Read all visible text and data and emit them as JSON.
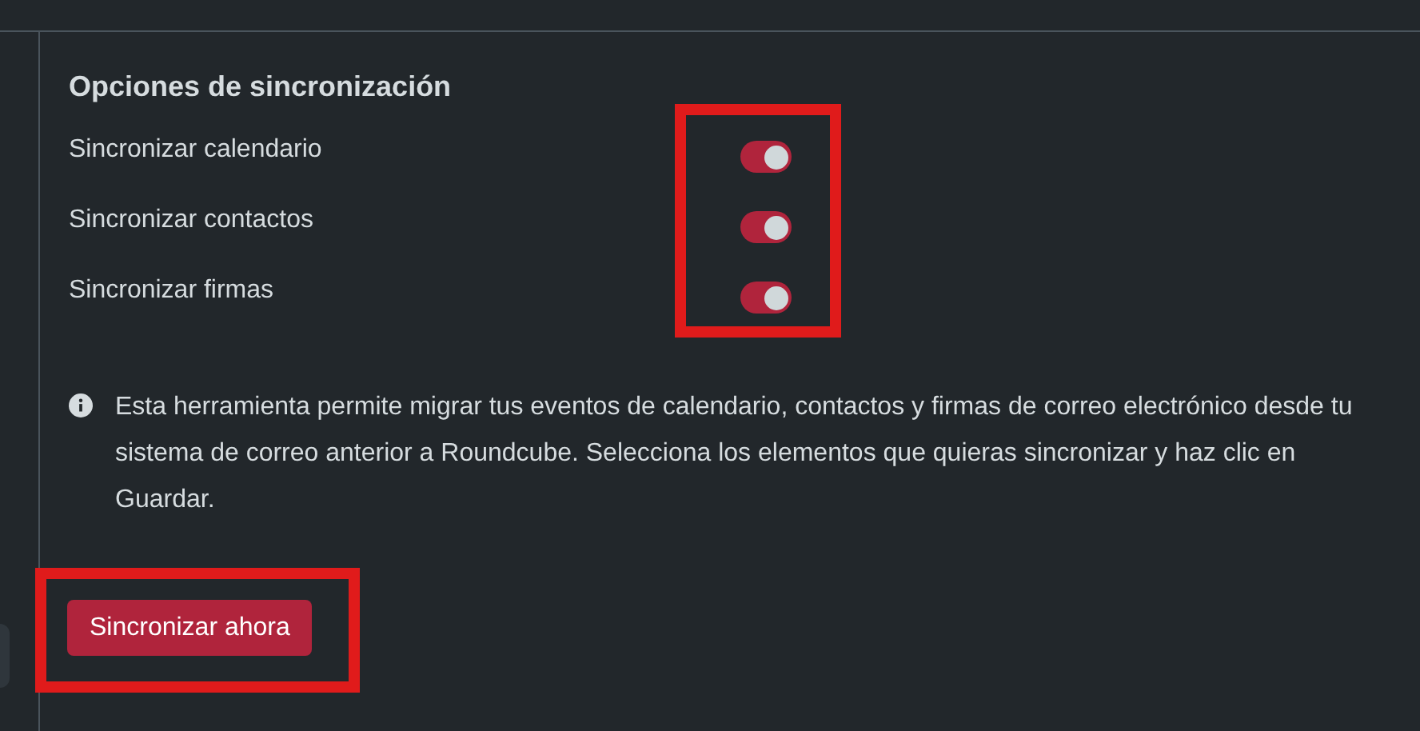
{
  "section": {
    "title": "Opciones de sincronización"
  },
  "options": [
    {
      "label": "Sincronizar calendario",
      "on": true
    },
    {
      "label": "Sincronizar contactos",
      "on": true
    },
    {
      "label": "Sincronizar firmas",
      "on": true
    }
  ],
  "info": {
    "text": "Esta herramienta permite migrar tus eventos de calendario, contactos y firmas de correo electrónico desde tu sistema de correo anterior a Roundcube. Selecciona los elementos que quieras sincronizar y haz clic en Guardar."
  },
  "button": {
    "label": "Sincronizar ahora"
  }
}
